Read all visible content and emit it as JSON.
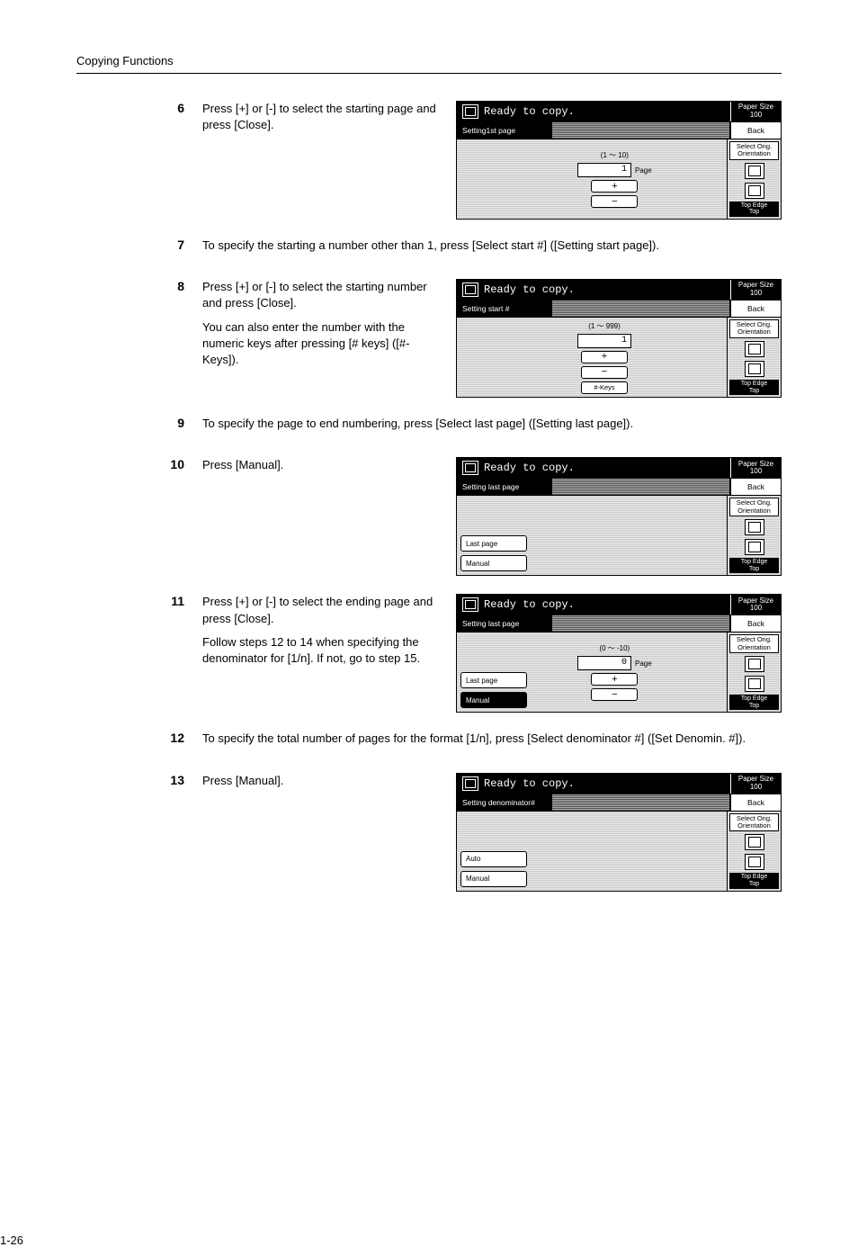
{
  "header": "Copying Functions",
  "page_number": "1-26",
  "common_panel": {
    "ready": "Ready to copy.",
    "paper_size": "Paper Size",
    "paper_ratio": "100",
    "back": "Back",
    "select_orig": "Select Orig.\nOrientation",
    "top_edge": "Top Edge\nTop"
  },
  "steps": [
    {
      "num": "6",
      "text": [
        "Press [+] or [-] to select the starting page and press [Close]."
      ],
      "panel": {
        "strip_label": "Setting1st page",
        "range": "(1 ～ 10)",
        "value": "1",
        "unit": "Page",
        "show_pm": true
      }
    },
    {
      "num": "7",
      "text": [
        "To specify the starting a number other than 1, press [Select start #] ([Setting start page])."
      ]
    },
    {
      "num": "8",
      "text": [
        "Press [+] or [-] to select the starting number and press [Close].",
        "You can also enter the number with the numeric keys after pressing [# keys] ([#-Keys])."
      ],
      "panel": {
        "strip_label": "Setting start #",
        "range": "(1 ～ 999)",
        "value": "1",
        "show_pm": true,
        "show_hash": true
      }
    },
    {
      "num": "9",
      "text": [
        "To specify the page to end numbering, press [Select last page] ([Setting last page])."
      ]
    },
    {
      "num": "10",
      "text": [
        "Press [Manual]."
      ],
      "panel": {
        "strip_label": "Setting last page",
        "left_buttons": [
          {
            "label": "Last page",
            "active": false
          },
          {
            "label": "Manual",
            "active": false
          }
        ]
      }
    },
    {
      "num": "11",
      "text": [
        "Press [+] or [-] to select the ending page and press [Close].",
        "Follow steps 12 to 14 when specifying the denominator for [1/n]. If not, go to step 15."
      ],
      "panel": {
        "strip_label": "Setting last page",
        "range": "(0 ～ -10)",
        "value": "0",
        "unit": "Page",
        "show_pm": true,
        "left_buttons": [
          {
            "label": "Last page",
            "active": false
          },
          {
            "label": "Manual",
            "active": true
          }
        ]
      }
    },
    {
      "num": "12",
      "text": [
        "To specify the total number of pages for the format [1/n], press [Select denominator #] ([Set Denomin. #])."
      ]
    },
    {
      "num": "13",
      "text": [
        "Press [Manual]."
      ],
      "panel": {
        "strip_label": "Setting denominator#",
        "left_buttons": [
          {
            "label": "Auto",
            "active": false
          },
          {
            "label": "Manual",
            "active": false
          }
        ]
      }
    }
  ]
}
